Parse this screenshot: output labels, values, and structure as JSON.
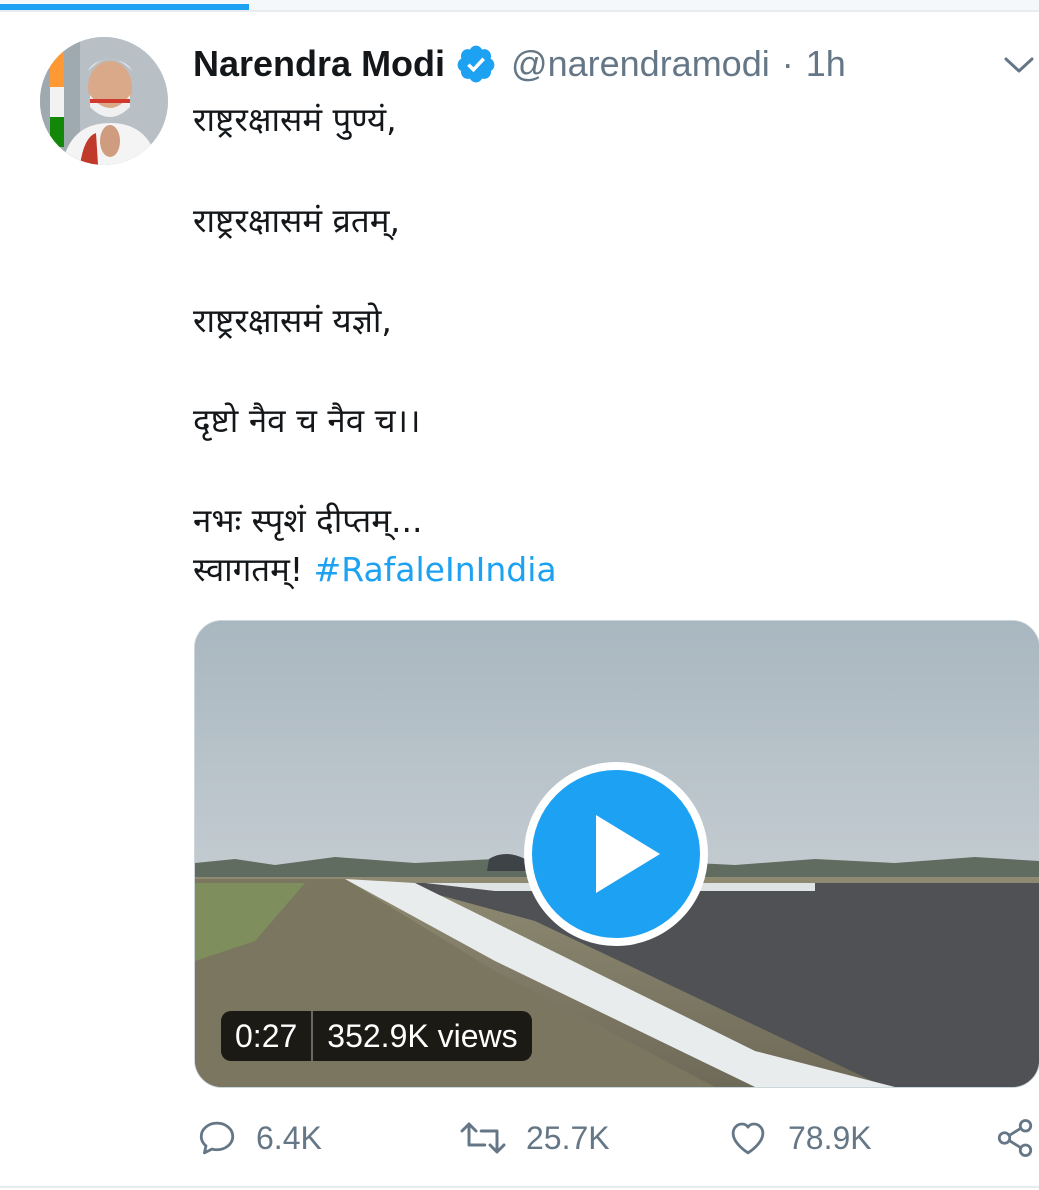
{
  "tweet": {
    "author": {
      "display_name": "Narendra Modi",
      "handle": "@narendramodi",
      "verified": true
    },
    "separator": "·",
    "time_ago": "1h",
    "text_lines": [
      "राष्ट्ररक्षासमं पुण्यं,",
      "राष्ट्ररक्षासमं व्रतम्,",
      "राष्ट्ररक्षासमं यज्ञो,",
      "दृष्टो नैव च नैव च।।",
      "नभः स्पृशं दीप्तम्...",
      "स्वागतम्!"
    ],
    "hashtag": "#RafaleInIndia",
    "media": {
      "type": "video",
      "duration": "0:27",
      "views": "352.9K views"
    },
    "stats": {
      "replies": "6.4K",
      "retweets": "25.7K",
      "likes": "78.9K"
    }
  },
  "icons": {
    "caret": "chevron-down-icon",
    "verified": "verified-badge-icon",
    "reply": "reply-icon",
    "retweet": "retweet-icon",
    "like": "heart-icon",
    "share": "share-icon",
    "play": "play-icon"
  },
  "colors": {
    "accent": "#1da1f2",
    "text": "#14171a",
    "secondary": "#657786",
    "divider": "#e6ecf0"
  },
  "load_progress": 0.24
}
